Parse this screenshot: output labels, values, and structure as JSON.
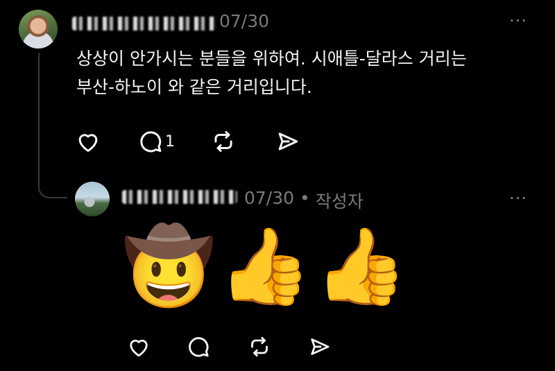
{
  "post": {
    "date": "07/30",
    "text_line1": "상상이 안가시는 분들을 위하여. 시애틀-달라스 거리는",
    "text_line2": "부산-하노이 와 같은 거리입니다.",
    "more": "···",
    "reply_count": "1"
  },
  "reply": {
    "date": "07/30",
    "separator": "•",
    "author_badge": "작성자",
    "more": "···",
    "emojis": [
      "🤠",
      "👍",
      "👍"
    ]
  },
  "icons": {
    "like": "heart-icon",
    "comment": "comment-icon",
    "repost": "repost-icon",
    "share": "share-icon"
  }
}
